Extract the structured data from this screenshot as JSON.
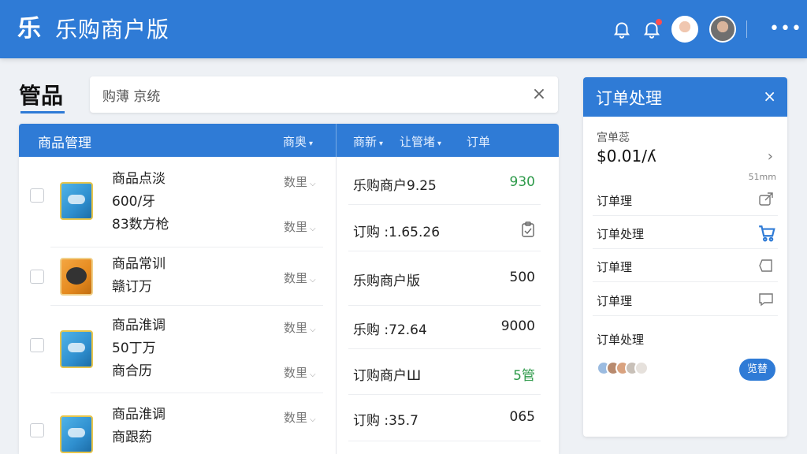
{
  "topbar": {
    "logo_glyph": "乐",
    "title": "乐购商户版",
    "icons": [
      "bell-icon",
      "bell-alert-icon",
      "avatar",
      "avatar",
      "more-icon"
    ]
  },
  "page": {
    "title": "管品"
  },
  "search": {
    "value": "购薄 京统",
    "clear_glyph": "×"
  },
  "table": {
    "header_title": "商品管理",
    "header_cols": [
      "商奥",
      "商新",
      "让管堵",
      "订单"
    ],
    "rows": [
      {
        "name_lines": [
          "商品点淡",
          "600/牙",
          "83数方枪"
        ],
        "sort_tags": [
          "数里",
          "数里"
        ],
        "right": [
          {
            "text": "乐购商户9.25",
            "value": "930",
            "value_green": true
          },
          {
            "text": "订购 :1.65.26",
            "value_icon": "clipboard-icon"
          }
        ]
      },
      {
        "name_lines": [
          "商品常训",
          "赣订万"
        ],
        "sort_tags": [
          "数里"
        ],
        "right": [
          {
            "text": "乐购商户版",
            "value": "500"
          }
        ]
      },
      {
        "name_lines": [
          "商品淮调",
          "50丁万",
          "商合历"
        ],
        "sort_tags": [
          "数里",
          "数里"
        ],
        "right": [
          {
            "text": "乐购 :72.64",
            "value": "9000"
          },
          {
            "text": "订购商户Ш",
            "value": "5管",
            "value_green": true
          }
        ]
      },
      {
        "name_lines": [
          "商品淮调",
          "商跟葯"
        ],
        "sort_tags": [
          "数里"
        ],
        "right": [
          {
            "text": "订购 :35.7",
            "value": "065"
          }
        ]
      }
    ]
  },
  "side": {
    "title": "订单处理",
    "close_glyph": "×",
    "label": "宫单蕊",
    "price": "$0.01/ʎ",
    "arrow": "›",
    "small": "51mm",
    "items": [
      {
        "label": "订单理",
        "icon": "share-icon"
      },
      {
        "label": "订单处理",
        "icon": "cart-icon"
      },
      {
        "label": "订单理",
        "icon": "tag-icon"
      },
      {
        "label": "订单理",
        "icon": "chat-icon"
      }
    ],
    "last_label": "订单处理",
    "button": "览替"
  },
  "colors": {
    "brand_blue": "#2f7bd6",
    "green": "#2e9a4a",
    "alert_red": "#ff4d4f"
  }
}
